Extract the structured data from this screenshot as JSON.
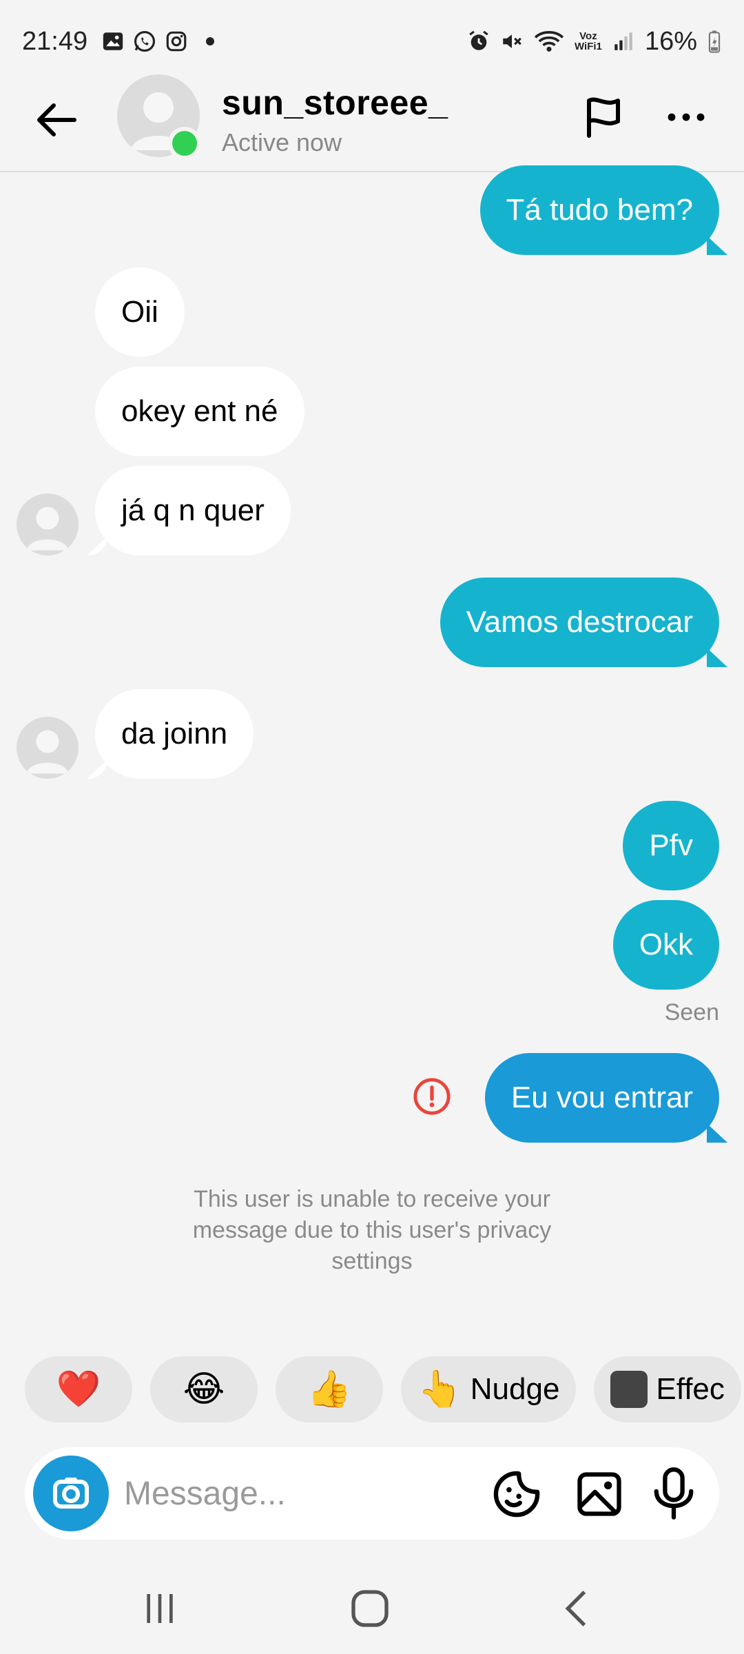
{
  "status_bar": {
    "time": "21:49",
    "network_label": "Voz WiFi1",
    "battery": "16%"
  },
  "header": {
    "username": "sun_storeee_",
    "status": "Active now"
  },
  "messages": [
    {
      "direction": "outgoing",
      "text": "Tá tudo bem?"
    },
    {
      "direction": "incoming",
      "text": "Oii"
    },
    {
      "direction": "incoming",
      "text": "okey ent né"
    },
    {
      "direction": "incoming",
      "text": "já q n quer"
    },
    {
      "direction": "outgoing",
      "text": "Vamos destrocar"
    },
    {
      "direction": "incoming",
      "text": "da joinn"
    },
    {
      "direction": "outgoing",
      "text": "Pfv"
    },
    {
      "direction": "outgoing",
      "text": "Okk"
    },
    {
      "direction": "outgoing",
      "text": "Eu vou entrar",
      "status": "failed"
    }
  ],
  "seen_label": "Seen",
  "notice": "This user is unable to receive your message due to this user's privacy settings",
  "quick_reactions": {
    "heart": "❤️",
    "laugh": "😂",
    "thumbs_up": "👍",
    "nudge_emoji": "👆",
    "nudge_label": "Nudge",
    "effects_label": "Effec"
  },
  "composer": {
    "placeholder": "Message..."
  },
  "colors": {
    "outgoing_bubble": "#16b3cf",
    "failed_bubble": "#1a9ad6",
    "online": "#2fd053",
    "error": "#e8453c"
  }
}
